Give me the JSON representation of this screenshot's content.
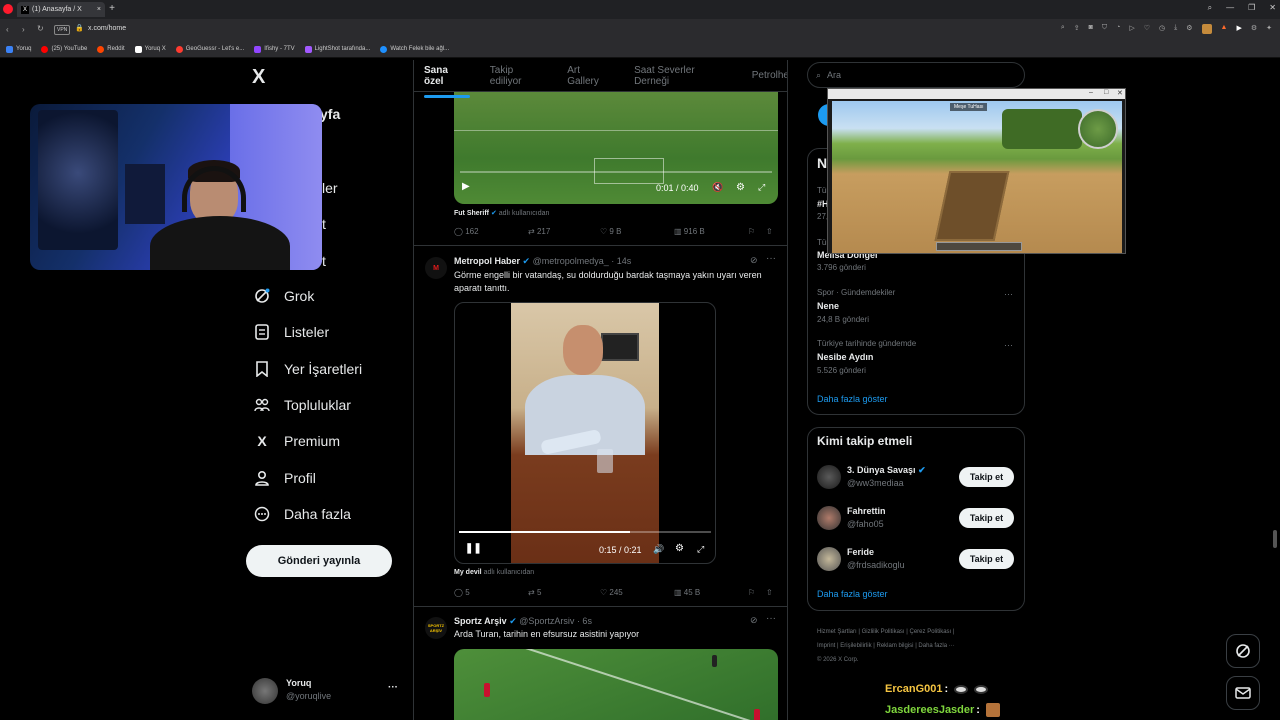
{
  "browser": {
    "tab_title": "(1) Anasayfa / X",
    "url": "x.com/home",
    "vpn": "VPN",
    "bookmarks": [
      "Yoruq",
      "(25) YouTube",
      "Reddit",
      "Yoruq X",
      "GeoGuessr - Let's e...",
      "Ifishy - 7TV",
      "LightShot tarafında...",
      "Watch Felek bile ağl..."
    ],
    "bookmark_colors": [
      "#3b82f6",
      "#ff0000",
      "#ff4500",
      "#ffffff",
      "#ff3b30",
      "#9146ff",
      "#a259ff",
      "#1e90ff"
    ]
  },
  "nav": {
    "logo": "X",
    "home_partial": "yfa",
    "partial1": "ler",
    "partial2": "t",
    "partial3": "t",
    "items": [
      {
        "label": "Grok",
        "icon": "grok-icon"
      },
      {
        "label": "Listeler",
        "icon": "list-icon"
      },
      {
        "label": "Yer İşaretleri",
        "icon": "bookmark-icon"
      },
      {
        "label": "Topluluklar",
        "icon": "communities-icon"
      },
      {
        "label": "Premium",
        "icon": "x-logo-icon"
      },
      {
        "label": "Profil",
        "icon": "profile-icon"
      },
      {
        "label": "Daha fazla",
        "icon": "more-circle-icon"
      }
    ],
    "post_button": "Gönderi yayınla",
    "account": {
      "name": "Yoruq",
      "handle": "@yoruqlive",
      "more": "···"
    }
  },
  "tabs": [
    "Sana özel",
    "Takip ediliyor",
    "Art Gallery",
    "Saat Severler Derneği",
    "Petrolhe"
  ],
  "posts": [
    {
      "video_time": "0:01 / 0:40",
      "credit_name": "Fut Sheriff",
      "credit_suffix": "adlı kullanıcıdan",
      "replies": "162",
      "reposts": "217",
      "likes": "9 B",
      "views": "916 B"
    },
    {
      "author": "Metropol Haber",
      "handle": "@metropolmedya_",
      "time": "· 14s",
      "text": "Görme engelli bir vatandaş, su doldurduğu bardak taşmaya yakın uyarı veren aparatı tanıttı.",
      "video_time": "0:15 / 0:21",
      "progress": 0.68,
      "credit_name": "My devil",
      "credit_suffix": "adlı kullanıcıdan",
      "replies": "5",
      "reposts": "5",
      "likes": "245",
      "views": "45 B"
    },
    {
      "author": "Sportz Arşiv",
      "handle": "@SportzArsiv",
      "time": "· 6s",
      "text": "Arda Turan, tarihin en efsursuz asistini yapıyor",
      "avatar_text": "SPORTZ ARŞİV"
    }
  ],
  "search": {
    "placeholder": "Ara"
  },
  "trends": {
    "header_partial": "N",
    "partial_items": [
      "Tür",
      "#H",
      "27,",
      "Tür"
    ],
    "items": [
      {
        "context": "",
        "title": "Melisa Döngel",
        "posts": "3.796 gönderi"
      },
      {
        "context": "Spor · Gündemdekiler",
        "title": "Nene",
        "posts": "24,8 B gönderi"
      },
      {
        "context": "Türkiye tarihinde gündemde",
        "title": "Nesibe Aydın",
        "posts": "5.526 gönderi"
      }
    ],
    "show_more": "Daha fazla göster"
  },
  "who_to_follow": {
    "title": "Kimi takip etmeli",
    "button": "Takip et",
    "users": [
      {
        "name": "3. Dünya Savaşı",
        "handle": "@ww3mediaa",
        "verified": true
      },
      {
        "name": "Fahrettin",
        "handle": "@faho05",
        "verified": false
      },
      {
        "name": "Feride",
        "handle": "@frdsadikoglu",
        "verified": false
      }
    ],
    "show_more": "Daha fazla göster"
  },
  "footer": {
    "links": [
      "Hizmet Şartları",
      "|",
      "Gizlilik Politikası",
      "|",
      "Çerez Politikası",
      "|",
      "Imprint",
      "|",
      "Erişilebilirlik",
      "|",
      "Reklam bilgisi",
      "|",
      "Daha fazla ···"
    ],
    "copyright": "© 2026 X Corp."
  },
  "chat": [
    {
      "user": "ErcanG001",
      "sep": ":",
      "color": "#f5c542"
    },
    {
      "user": "JasdereesJasder",
      "sep": ":",
      "color": "#7fd63d"
    }
  ],
  "game_window": {
    "title": "Meşe TuHası"
  }
}
